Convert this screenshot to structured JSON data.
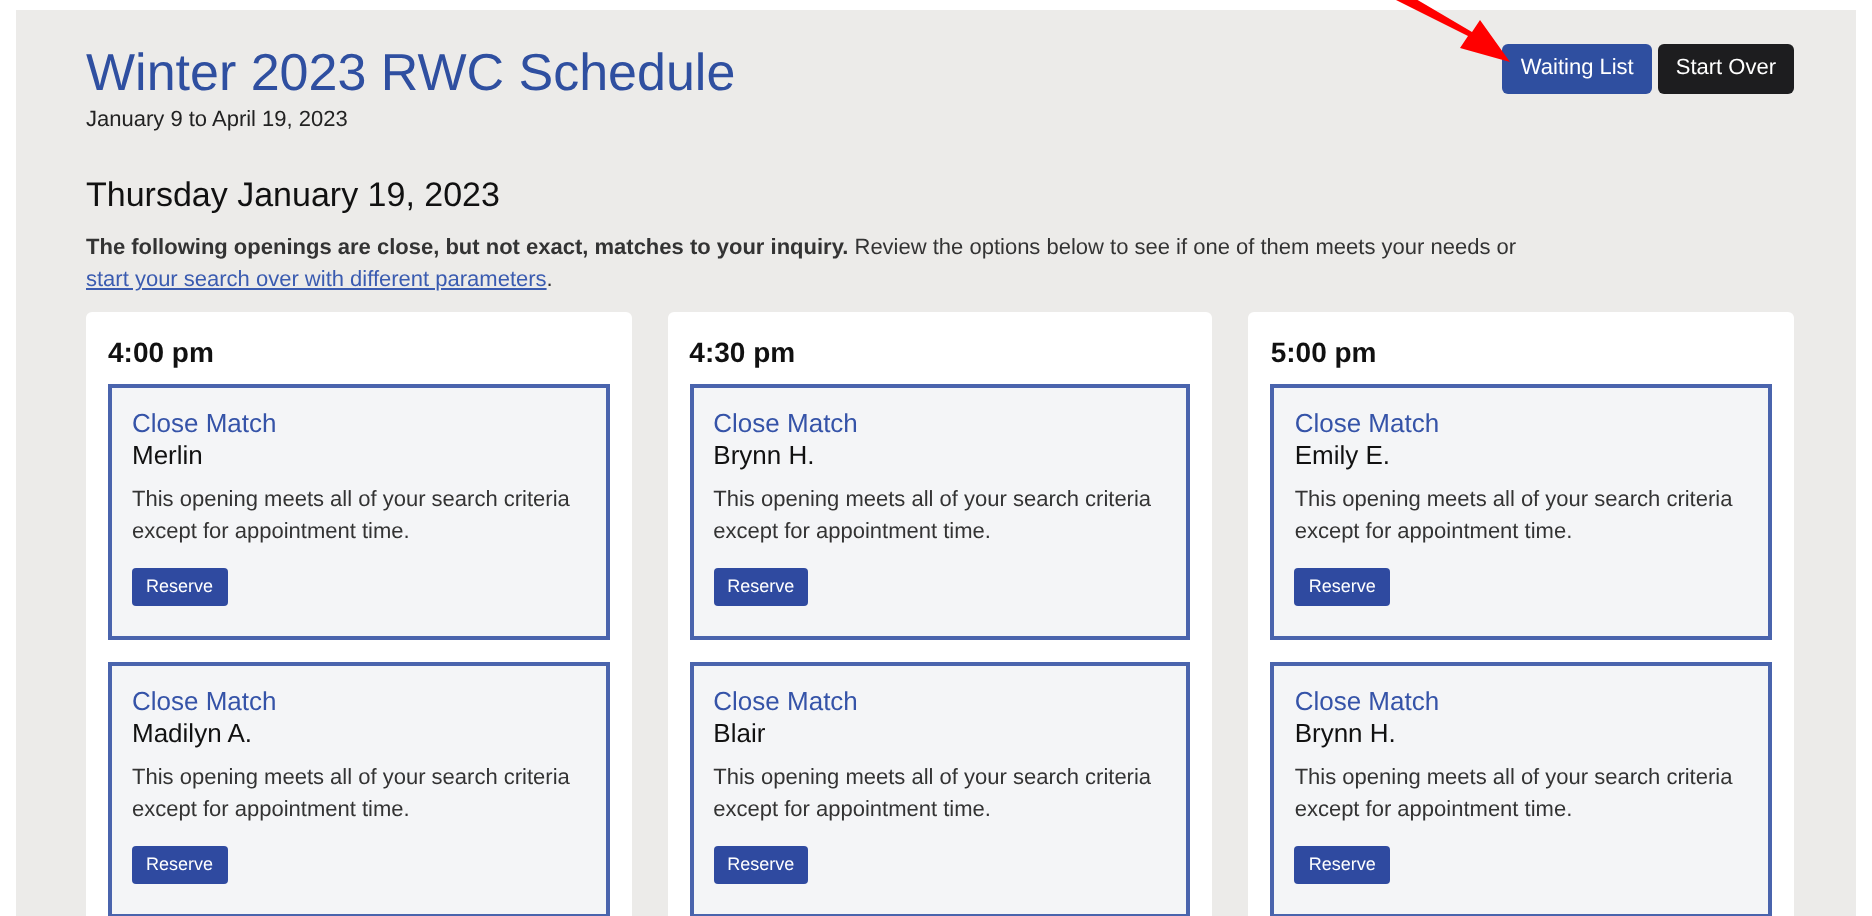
{
  "header": {
    "title": "Winter 2023 RWC Schedule",
    "subtitle": "January 9 to April 19, 2023"
  },
  "buttons": [
    {
      "label": "Waiting List",
      "kind": "primary"
    },
    {
      "label": "Start Over",
      "kind": "dark"
    }
  ],
  "date_heading": "Thursday January 19, 2023",
  "intro": {
    "text": "**The following openings are close, but not exact, matches to your inquiry.** Review the options below to see if one of them meets your needs or",
    "link": "start your search over with different parameters",
    "end": "."
  },
  "columns": [
    {
      "time": "4:00 pm",
      "slots": [
        {
          "match": "Close Match",
          "name": "Merlin",
          "description": "This opening meets all of your search criteria except for appointment time.",
          "button": "Reserve"
        },
        {
          "match": "Close Match",
          "name": "Madilyn A.",
          "description": "This opening meets all of your search criteria except for appointment time.",
          "button": "Reserve"
        }
      ]
    },
    {
      "time": "4:30 pm",
      "slots": [
        {
          "match": "Close Match",
          "name": "Brynn H.",
          "description": "This opening meets all of your search criteria except for appointment time.",
          "button": "Reserve"
        },
        {
          "match": "Close Match",
          "name": "Blair",
          "description": "This opening meets all of your search criteria except for appointment time.",
          "button": "Reserve"
        }
      ]
    },
    {
      "time": "5:00 pm",
      "slots": [
        {
          "match": "Close Match",
          "name": "Emily E.",
          "description": "This opening meets all of your search criteria except for appointment time.",
          "button": "Reserve"
        },
        {
          "match": "Close Match",
          "name": "Brynn H.",
          "description": "This opening meets all of your search criteria except for appointment time.",
          "button": "Reserve"
        }
      ]
    }
  ]
}
